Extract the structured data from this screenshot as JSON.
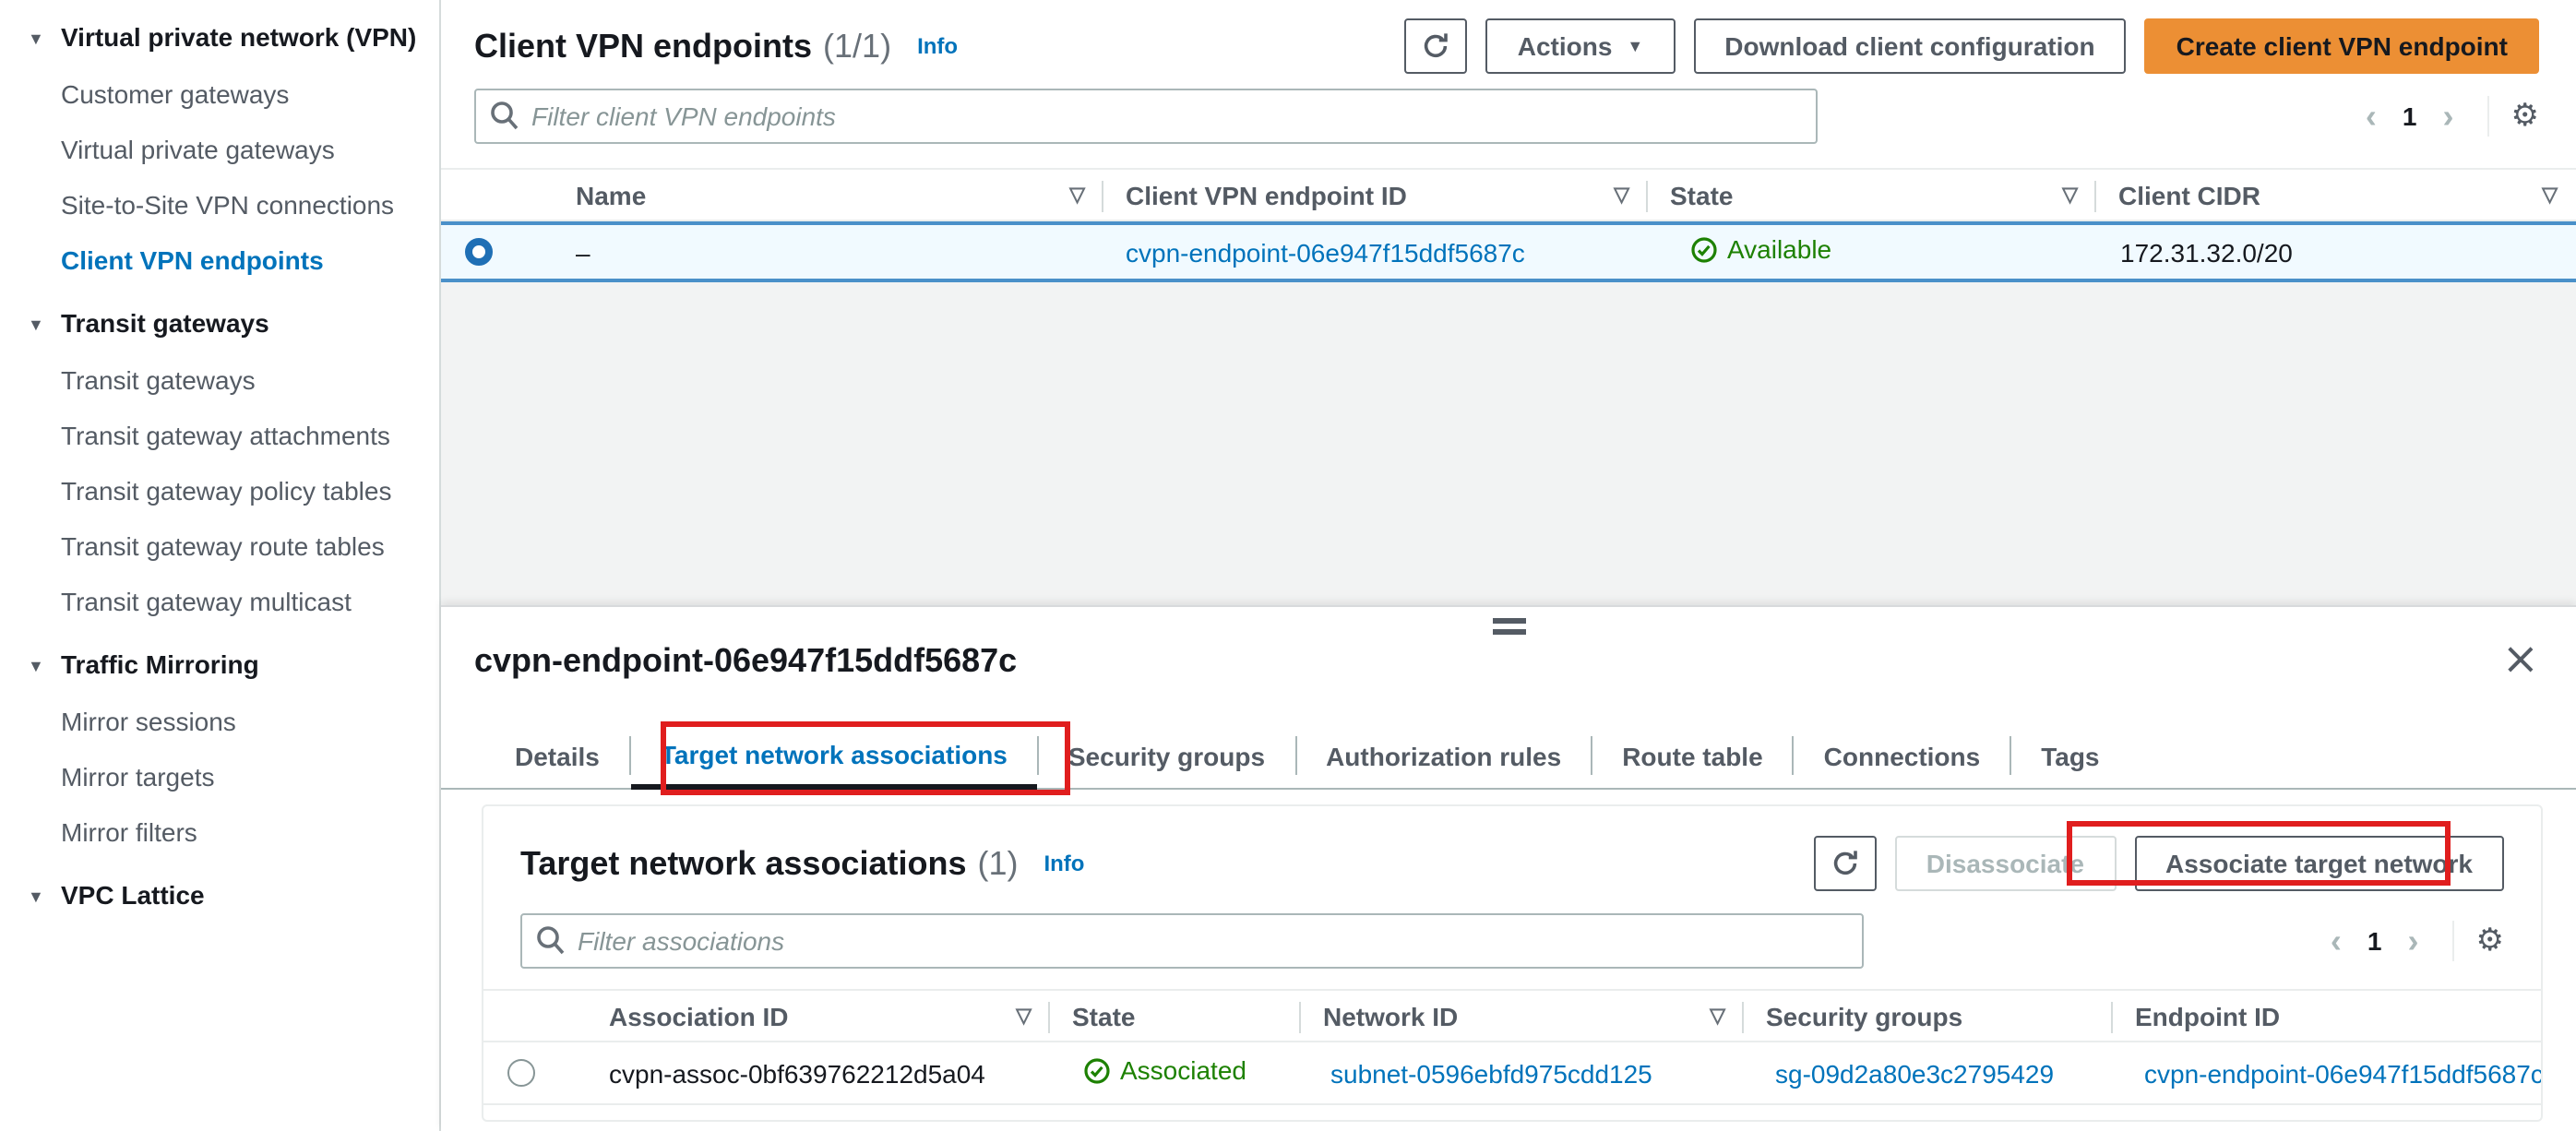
{
  "colors": {
    "accent_orange": "#ec8f34",
    "link_blue": "#0073bb",
    "active_nav_blue": "#0073bb",
    "status_green": "#1d8102",
    "selected_row_bg": "#f1faff",
    "selected_row_border": "#4a90c9",
    "annotation_red": "#e01e1e"
  },
  "sidebar": {
    "sections": [
      {
        "label": "Virtual private network (VPN)",
        "items": [
          "Customer gateways",
          "Virtual private gateways",
          "Site-to-Site VPN connections",
          "Client VPN endpoints"
        ],
        "active_item": "Client VPN endpoints"
      },
      {
        "label": "Transit gateways",
        "items": [
          "Transit gateways",
          "Transit gateway attachments",
          "Transit gateway policy tables",
          "Transit gateway route tables",
          "Transit gateway multicast"
        ]
      },
      {
        "label": "Traffic Mirroring",
        "items": [
          "Mirror sessions",
          "Mirror targets",
          "Mirror filters"
        ]
      },
      {
        "label": "VPC Lattice",
        "items": []
      }
    ]
  },
  "header": {
    "title": "Client VPN endpoints",
    "count": "(1/1)",
    "info_label": "Info",
    "actions_label": "Actions",
    "download_label": "Download client configuration",
    "create_label": "Create client VPN endpoint",
    "page": "1"
  },
  "filter": {
    "placeholder": "Filter client VPN endpoints"
  },
  "endpoints_table": {
    "columns": [
      "Name",
      "Client VPN endpoint ID",
      "State",
      "Client CIDR"
    ],
    "row": {
      "name": "–",
      "endpoint_id": "cvpn-endpoint-06e947f15ddf5687c",
      "state": "Available",
      "client_cidr": "172.31.32.0/20"
    }
  },
  "panel": {
    "title": "cvpn-endpoint-06e947f15ddf5687c",
    "tabs": [
      "Details",
      "Target network associations",
      "Security groups",
      "Authorization rules",
      "Route table",
      "Connections",
      "Tags"
    ],
    "active_tab": "Target network associations",
    "associations": {
      "title": "Target network associations",
      "count": "(1)",
      "info_label": "Info",
      "disassociate_label": "Disassociate",
      "associate_label": "Associate target network",
      "filter_placeholder": "Filter associations",
      "page": "1",
      "columns": [
        "Association ID",
        "State",
        "Network ID",
        "Security groups",
        "Endpoint ID"
      ],
      "row": {
        "association_id": "cvpn-assoc-0bf639762212d5a04",
        "state": "Associated",
        "network_id": "subnet-0596ebfd975cdd125",
        "security_groups": "sg-09d2a80e3c2795429",
        "endpoint_id": "cvpn-endpoint-06e947f15ddf5687c"
      }
    }
  }
}
